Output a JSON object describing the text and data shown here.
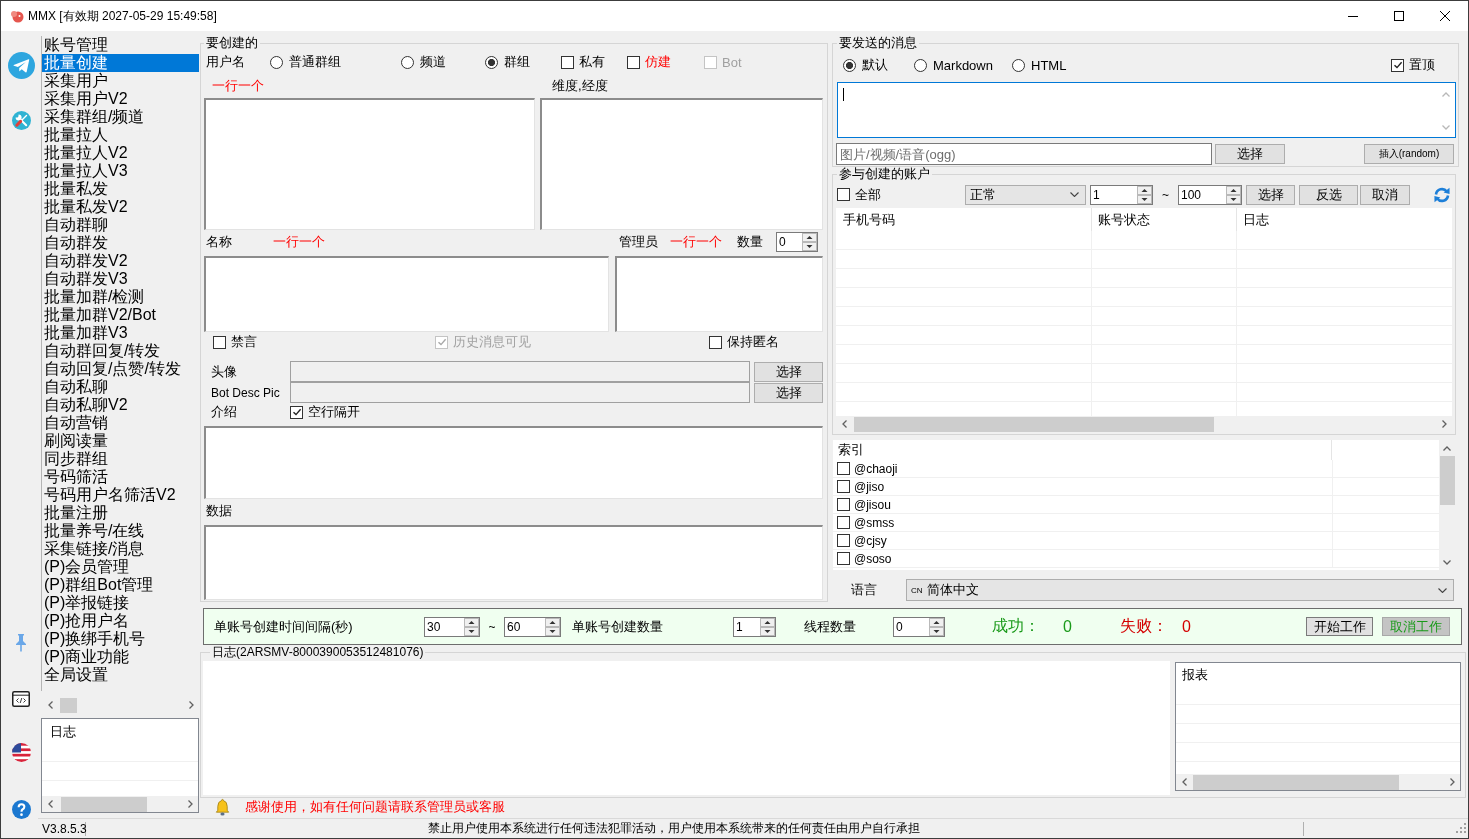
{
  "window": {
    "title": "MMX [有效期 2027-05-29 15:49:58]"
  },
  "sidebar": {
    "items": [
      {
        "label": "账号管理",
        "selected": false
      },
      {
        "label": "批量创建",
        "selected": true
      },
      {
        "label": "采集用户",
        "selected": false
      },
      {
        "label": "采集用户V2",
        "selected": false
      },
      {
        "label": "采集群组/频道",
        "selected": false
      },
      {
        "label": "批量拉人",
        "selected": false
      },
      {
        "label": "批量拉人V2",
        "selected": false
      },
      {
        "label": "批量拉人V3",
        "selected": false
      },
      {
        "label": "批量私发",
        "selected": false
      },
      {
        "label": "批量私发V2",
        "selected": false
      },
      {
        "label": "自动群聊",
        "selected": false
      },
      {
        "label": "自动群发",
        "selected": false
      },
      {
        "label": "自动群发V2",
        "selected": false
      },
      {
        "label": "自动群发V3",
        "selected": false
      },
      {
        "label": "批量加群/检测",
        "selected": false
      },
      {
        "label": "批量加群V2/Bot",
        "selected": false
      },
      {
        "label": "批量加群V3",
        "selected": false
      },
      {
        "label": "自动群回复/转发",
        "selected": false
      },
      {
        "label": "自动回复/点赞/转发",
        "selected": false
      },
      {
        "label": "自动私聊",
        "selected": false
      },
      {
        "label": "自动私聊V2",
        "selected": false
      },
      {
        "label": "自动营销",
        "selected": false
      },
      {
        "label": "刷阅读量",
        "selected": false
      },
      {
        "label": "同步群组",
        "selected": false
      },
      {
        "label": "号码筛活",
        "selected": false
      },
      {
        "label": "号码用户名筛活V2",
        "selected": false
      },
      {
        "label": "批量注册",
        "selected": false
      },
      {
        "label": "批量养号/在线",
        "selected": false
      },
      {
        "label": "采集链接/消息",
        "selected": false
      },
      {
        "label": "(P)会员管理",
        "selected": false
      },
      {
        "label": "(P)群组Bot管理",
        "selected": false
      },
      {
        "label": "(P)举报链接",
        "selected": false
      },
      {
        "label": "(P)抢用户名",
        "selected": false
      },
      {
        "label": "(P)换绑手机号",
        "selected": false
      },
      {
        "label": "(P)商业功能",
        "selected": false
      },
      {
        "label": "全局设置",
        "selected": false
      }
    ]
  },
  "sidebar_log": {
    "header": "日志"
  },
  "create_group": {
    "title": "要创建的",
    "username_label": "用户名",
    "type_options": [
      {
        "label": "普通群组",
        "selected": false
      },
      {
        "label": "频道",
        "selected": false
      },
      {
        "label": "群组",
        "selected": true
      }
    ],
    "flags": [
      {
        "label": "私有",
        "checked": false,
        "disabled": false,
        "emphasized": false
      },
      {
        "label": "仿建",
        "checked": false,
        "disabled": false,
        "emphasized": true
      },
      {
        "label": "Bot",
        "checked": false,
        "disabled": true,
        "emphasized": false
      }
    ],
    "username_hint": "一行一个",
    "coords_label": "维度,经度",
    "name_label": "名称",
    "name_hint": "一行一个",
    "admin_label": "管理员",
    "admin_hint": "一行一个",
    "count_label": "数量",
    "count_value": "0",
    "options": [
      {
        "label": "禁言",
        "checked": false,
        "disabled": false
      },
      {
        "label": "历史消息可见",
        "checked": true,
        "disabled": true
      },
      {
        "label": "保持匿名",
        "checked": false,
        "disabled": false
      }
    ],
    "file_rows": [
      {
        "label": "头像",
        "button": "选择"
      },
      {
        "label": "Bot Desc Pic",
        "button": "选择"
      }
    ],
    "intro_label": "介绍",
    "blank_line_split": {
      "label": "空行隔开",
      "checked": true
    },
    "data_label": "数据"
  },
  "message_group": {
    "title": "要发送的消息",
    "formats": [
      {
        "label": "默认",
        "selected": true
      },
      {
        "label": "Markdown",
        "selected": false
      },
      {
        "label": "HTML",
        "selected": false
      }
    ],
    "pin_top": {
      "label": "置顶",
      "checked": true
    },
    "message_box": {
      "focused": true
    },
    "media": {
      "placeholder": "图片/视频/语音(ogg)",
      "button": "选择"
    },
    "insert_button": "插入(random)"
  },
  "accounts_group": {
    "title": "参与创建的账户",
    "select_all": {
      "label": "全部",
      "checked": false
    },
    "status_filter": "正常",
    "range_from": "1",
    "range_separator": "~",
    "range_to": "100",
    "buttons": [
      "选择",
      "反选",
      "取消"
    ],
    "table": {
      "columns": [
        "手机号码",
        "账号状态",
        "日志"
      ]
    }
  },
  "index_list": {
    "header": "索引",
    "items": [
      {
        "label": "@chaoji",
        "checked": false
      },
      {
        "label": "@jiso",
        "checked": false
      },
      {
        "label": "@jisou",
        "checked": false
      },
      {
        "label": "@smss",
        "checked": false
      },
      {
        "label": "@cjsy",
        "checked": false
      },
      {
        "label": "@soso",
        "checked": false
      }
    ]
  },
  "language": {
    "label": "语言",
    "region_code": "CN",
    "value": "简体中文"
  },
  "settings_bar": {
    "interval_label": "单账号创建时间间隔(秒)",
    "interval_from": "30",
    "interval_separator": "~",
    "interval_to": "60",
    "count_label": "单账号创建数量",
    "count_value": "1",
    "threads_label": "线程数量",
    "threads_value": "0",
    "success_label": "成功：",
    "success_value": "0",
    "fail_label": "失败：",
    "fail_value": "0",
    "buttons": [
      {
        "label": "开始工作",
        "kind": "start"
      },
      {
        "label": "取消工作",
        "kind": "cancel"
      }
    ]
  },
  "log_group": {
    "title": "日志(2ARSMV-8000390053512481076)",
    "report_header": "报表"
  },
  "notice": "感谢使用，如有任何问题请联系管理员或客服",
  "status_bar": {
    "version": "V3.8.5.3",
    "message": "禁止用户使用本系统进行任何违法犯罪活动，用户使用本系统带来的任何责任由用户自行承担"
  }
}
